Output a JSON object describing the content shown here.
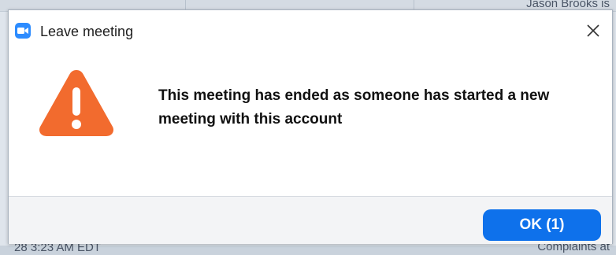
{
  "dialog": {
    "title": "Leave meeting",
    "title_icon": "zoom-app-icon",
    "close_icon": "close-icon",
    "alert_icon": "warning-triangle-icon",
    "message": "This meeting has ended as someone has started a new meeting with this account",
    "ok_label": "OK (1)"
  },
  "background": {
    "top_right_text": "Jason Brooks is",
    "bottom_left_text": "28 3:23 AM EDT",
    "bottom_right_text": "Complaints at"
  },
  "colors": {
    "accent": "#0e71eb",
    "warning": "#f26b2e",
    "app_icon": "#2d8cff"
  }
}
